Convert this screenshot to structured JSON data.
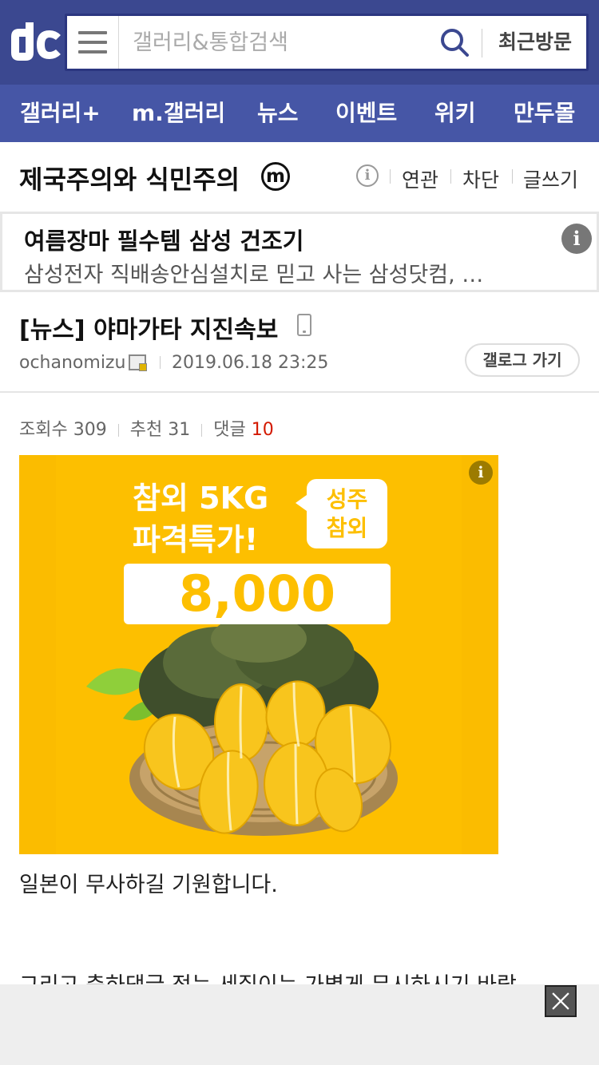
{
  "header": {
    "search_placeholder": "갤러리&통합검색",
    "recent_label": "최근방문"
  },
  "nav": {
    "items": [
      "갤러리+",
      "m.갤러리",
      "뉴스",
      "이벤트",
      "위키",
      "만두몰"
    ]
  },
  "gallery": {
    "title": "제국주의와 식민주의",
    "minor_badge": "m",
    "info_icon": "info-icon",
    "links": [
      "연관",
      "차단",
      "글쓰기"
    ]
  },
  "ad": {
    "title": "여름장마 필수템 삼성 건조기",
    "description": "삼성전자 직배송안심설치로 믿고 사는 삼성닷컴, …",
    "info_icon": "i"
  },
  "post": {
    "title": "[뉴스] 야마가타 지진속보",
    "author": "ochanomizu",
    "date": "2019.06.18 23:25",
    "galog_button": "갤로그 가기"
  },
  "stats": {
    "views_label": "조회수",
    "views": "309",
    "recommend_label": "추천",
    "recommend": "31",
    "comments_label": "댓글",
    "comments": "10"
  },
  "banner": {
    "info": "i",
    "headline_line1": "참외 5KG",
    "headline_line2": "파격특가!",
    "bubble_line1": "성주",
    "bubble_line2": "참외",
    "price": "8,000"
  },
  "body": {
    "line1": "일본이 무사하길 기원합니다.",
    "line2": "그리고 축하댓글 적는 세질이는 가볍게 무시하시기 바랍"
  },
  "colors": {
    "header_bg": "#3b4890",
    "nav_bg": "#4656a6",
    "banner_bg": "#fdbf00",
    "comment_count": "#d31900"
  }
}
